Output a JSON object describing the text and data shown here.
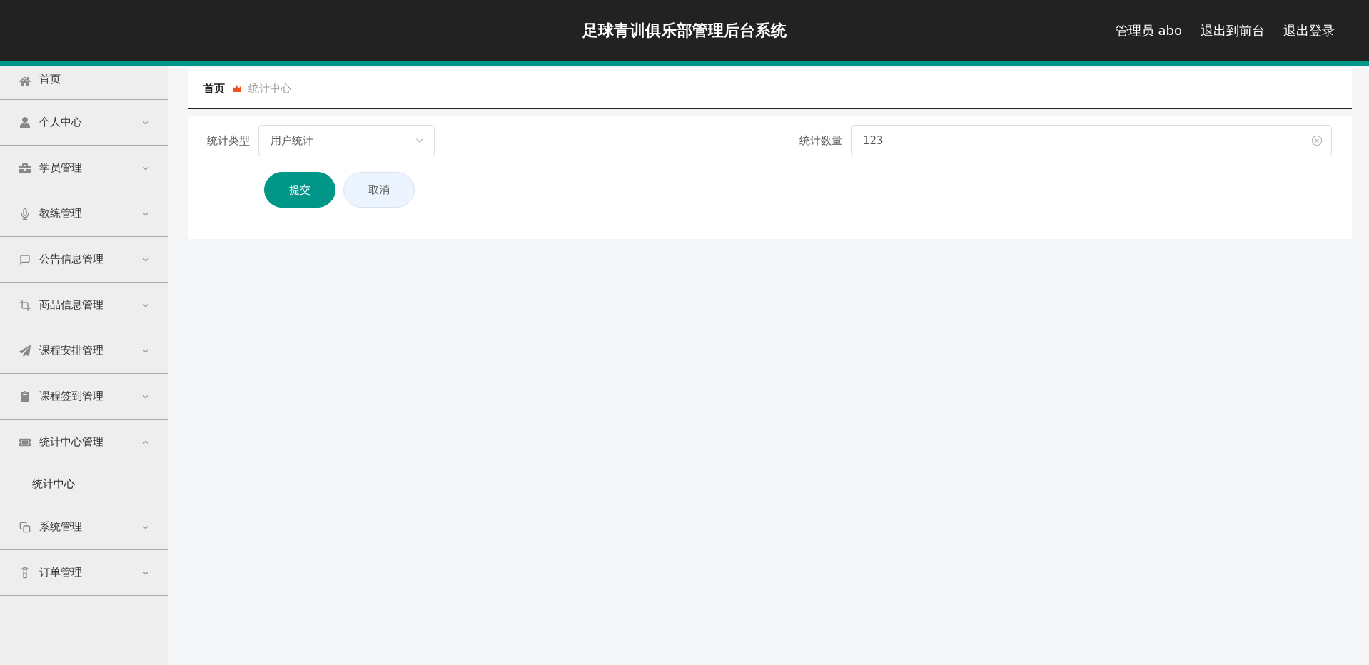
{
  "header": {
    "title": "足球青训俱乐部管理后台系统",
    "user": "管理员 abo",
    "links": [
      "退出到前台",
      "退出登录"
    ]
  },
  "sidebar": {
    "items": [
      {
        "label": "首页",
        "expandable": false
      },
      {
        "label": "个人中心",
        "expandable": true,
        "expanded": false
      },
      {
        "label": "学员管理",
        "expandable": true,
        "expanded": false
      },
      {
        "label": "教练管理",
        "expandable": true,
        "expanded": false
      },
      {
        "label": "公告信息管理",
        "expandable": true,
        "expanded": false
      },
      {
        "label": "商品信息管理",
        "expandable": true,
        "expanded": false
      },
      {
        "label": "课程安排管理",
        "expandable": true,
        "expanded": false
      },
      {
        "label": "课程签到管理",
        "expandable": true,
        "expanded": false
      },
      {
        "label": "统计中心管理",
        "expandable": true,
        "expanded": true,
        "children": [
          {
            "label": "统计中心"
          }
        ]
      },
      {
        "label": "系统管理",
        "expandable": true,
        "expanded": false
      },
      {
        "label": "订单管理",
        "expandable": true,
        "expanded": false
      }
    ]
  },
  "breadcrumb": [
    "首页",
    "统计中心"
  ],
  "form": {
    "fields": [
      {
        "label": "统计类型",
        "kind": "select",
        "value": "用户统计"
      },
      {
        "label": "统计数量",
        "kind": "input",
        "value": "123"
      }
    ],
    "buttons": [
      {
        "label": "提交",
        "kind": "primary"
      },
      {
        "label": "取消",
        "kind": "secondary"
      }
    ]
  }
}
